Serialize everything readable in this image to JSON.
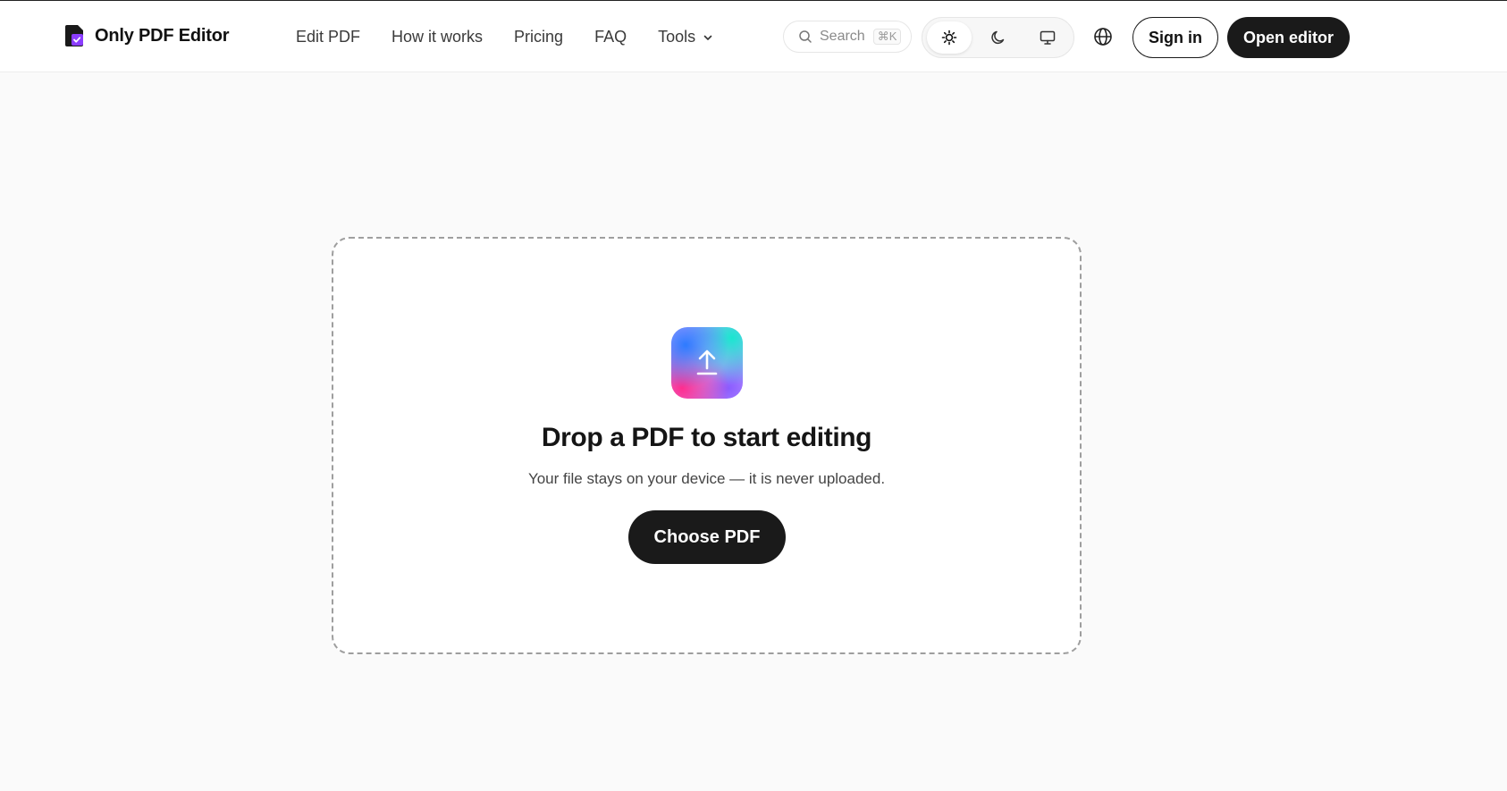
{
  "app": {
    "logo_text": "Only PDF Editor",
    "logo_icon": "pdf-document-check-icon",
    "brand_colors": {
      "purple": "#8b3dff",
      "dark": "#1a1a1a"
    }
  },
  "nav": {
    "items": [
      {
        "label": "Edit PDF"
      },
      {
        "label": "How it works"
      },
      {
        "label": "Pricing"
      },
      {
        "label": "FAQ"
      },
      {
        "label": "Tools",
        "icon": "chevron-down-icon"
      }
    ]
  },
  "search": {
    "placeholder": "Search",
    "shortcut": "⌘K",
    "icon": "search-icon"
  },
  "theme": {
    "options": [
      {
        "icon": "sun-icon",
        "active": true
      },
      {
        "icon": "moon-icon",
        "active": false
      },
      {
        "icon": "monitor-icon",
        "active": false
      }
    ]
  },
  "header_actions": {
    "language_icon": "globe-icon",
    "sign_in": "Sign in",
    "open_editor": "Open editor"
  },
  "dropzone": {
    "icon": "upload-icon",
    "title": "Drop a PDF to start editing",
    "subtitle": "Your file stays on your device — it is never uploaded.",
    "button": "Choose PDF"
  }
}
